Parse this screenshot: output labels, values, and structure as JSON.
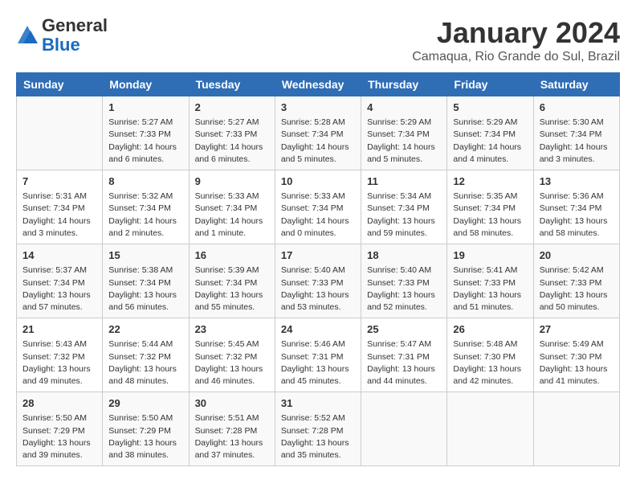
{
  "header": {
    "logo_line1": "General",
    "logo_line2": "Blue",
    "month": "January 2024",
    "location": "Camaqua, Rio Grande do Sul, Brazil"
  },
  "weekdays": [
    "Sunday",
    "Monday",
    "Tuesday",
    "Wednesday",
    "Thursday",
    "Friday",
    "Saturday"
  ],
  "weeks": [
    [
      {
        "day": "",
        "lines": []
      },
      {
        "day": "1",
        "lines": [
          "Sunrise: 5:27 AM",
          "Sunset: 7:33 PM",
          "Daylight: 14 hours",
          "and 6 minutes."
        ]
      },
      {
        "day": "2",
        "lines": [
          "Sunrise: 5:27 AM",
          "Sunset: 7:33 PM",
          "Daylight: 14 hours",
          "and 6 minutes."
        ]
      },
      {
        "day": "3",
        "lines": [
          "Sunrise: 5:28 AM",
          "Sunset: 7:34 PM",
          "Daylight: 14 hours",
          "and 5 minutes."
        ]
      },
      {
        "day": "4",
        "lines": [
          "Sunrise: 5:29 AM",
          "Sunset: 7:34 PM",
          "Daylight: 14 hours",
          "and 5 minutes."
        ]
      },
      {
        "day": "5",
        "lines": [
          "Sunrise: 5:29 AM",
          "Sunset: 7:34 PM",
          "Daylight: 14 hours",
          "and 4 minutes."
        ]
      },
      {
        "day": "6",
        "lines": [
          "Sunrise: 5:30 AM",
          "Sunset: 7:34 PM",
          "Daylight: 14 hours",
          "and 3 minutes."
        ]
      }
    ],
    [
      {
        "day": "7",
        "lines": [
          "Sunrise: 5:31 AM",
          "Sunset: 7:34 PM",
          "Daylight: 14 hours",
          "and 3 minutes."
        ]
      },
      {
        "day": "8",
        "lines": [
          "Sunrise: 5:32 AM",
          "Sunset: 7:34 PM",
          "Daylight: 14 hours",
          "and 2 minutes."
        ]
      },
      {
        "day": "9",
        "lines": [
          "Sunrise: 5:33 AM",
          "Sunset: 7:34 PM",
          "Daylight: 14 hours",
          "and 1 minute."
        ]
      },
      {
        "day": "10",
        "lines": [
          "Sunrise: 5:33 AM",
          "Sunset: 7:34 PM",
          "Daylight: 14 hours",
          "and 0 minutes."
        ]
      },
      {
        "day": "11",
        "lines": [
          "Sunrise: 5:34 AM",
          "Sunset: 7:34 PM",
          "Daylight: 13 hours",
          "and 59 minutes."
        ]
      },
      {
        "day": "12",
        "lines": [
          "Sunrise: 5:35 AM",
          "Sunset: 7:34 PM",
          "Daylight: 13 hours",
          "and 58 minutes."
        ]
      },
      {
        "day": "13",
        "lines": [
          "Sunrise: 5:36 AM",
          "Sunset: 7:34 PM",
          "Daylight: 13 hours",
          "and 58 minutes."
        ]
      }
    ],
    [
      {
        "day": "14",
        "lines": [
          "Sunrise: 5:37 AM",
          "Sunset: 7:34 PM",
          "Daylight: 13 hours",
          "and 57 minutes."
        ]
      },
      {
        "day": "15",
        "lines": [
          "Sunrise: 5:38 AM",
          "Sunset: 7:34 PM",
          "Daylight: 13 hours",
          "and 56 minutes."
        ]
      },
      {
        "day": "16",
        "lines": [
          "Sunrise: 5:39 AM",
          "Sunset: 7:34 PM",
          "Daylight: 13 hours",
          "and 55 minutes."
        ]
      },
      {
        "day": "17",
        "lines": [
          "Sunrise: 5:40 AM",
          "Sunset: 7:33 PM",
          "Daylight: 13 hours",
          "and 53 minutes."
        ]
      },
      {
        "day": "18",
        "lines": [
          "Sunrise: 5:40 AM",
          "Sunset: 7:33 PM",
          "Daylight: 13 hours",
          "and 52 minutes."
        ]
      },
      {
        "day": "19",
        "lines": [
          "Sunrise: 5:41 AM",
          "Sunset: 7:33 PM",
          "Daylight: 13 hours",
          "and 51 minutes."
        ]
      },
      {
        "day": "20",
        "lines": [
          "Sunrise: 5:42 AM",
          "Sunset: 7:33 PM",
          "Daylight: 13 hours",
          "and 50 minutes."
        ]
      }
    ],
    [
      {
        "day": "21",
        "lines": [
          "Sunrise: 5:43 AM",
          "Sunset: 7:32 PM",
          "Daylight: 13 hours",
          "and 49 minutes."
        ]
      },
      {
        "day": "22",
        "lines": [
          "Sunrise: 5:44 AM",
          "Sunset: 7:32 PM",
          "Daylight: 13 hours",
          "and 48 minutes."
        ]
      },
      {
        "day": "23",
        "lines": [
          "Sunrise: 5:45 AM",
          "Sunset: 7:32 PM",
          "Daylight: 13 hours",
          "and 46 minutes."
        ]
      },
      {
        "day": "24",
        "lines": [
          "Sunrise: 5:46 AM",
          "Sunset: 7:31 PM",
          "Daylight: 13 hours",
          "and 45 minutes."
        ]
      },
      {
        "day": "25",
        "lines": [
          "Sunrise: 5:47 AM",
          "Sunset: 7:31 PM",
          "Daylight: 13 hours",
          "and 44 minutes."
        ]
      },
      {
        "day": "26",
        "lines": [
          "Sunrise: 5:48 AM",
          "Sunset: 7:30 PM",
          "Daylight: 13 hours",
          "and 42 minutes."
        ]
      },
      {
        "day": "27",
        "lines": [
          "Sunrise: 5:49 AM",
          "Sunset: 7:30 PM",
          "Daylight: 13 hours",
          "and 41 minutes."
        ]
      }
    ],
    [
      {
        "day": "28",
        "lines": [
          "Sunrise: 5:50 AM",
          "Sunset: 7:29 PM",
          "Daylight: 13 hours",
          "and 39 minutes."
        ]
      },
      {
        "day": "29",
        "lines": [
          "Sunrise: 5:50 AM",
          "Sunset: 7:29 PM",
          "Daylight: 13 hours",
          "and 38 minutes."
        ]
      },
      {
        "day": "30",
        "lines": [
          "Sunrise: 5:51 AM",
          "Sunset: 7:28 PM",
          "Daylight: 13 hours",
          "and 37 minutes."
        ]
      },
      {
        "day": "31",
        "lines": [
          "Sunrise: 5:52 AM",
          "Sunset: 7:28 PM",
          "Daylight: 13 hours",
          "and 35 minutes."
        ]
      },
      {
        "day": "",
        "lines": []
      },
      {
        "day": "",
        "lines": []
      },
      {
        "day": "",
        "lines": []
      }
    ]
  ]
}
